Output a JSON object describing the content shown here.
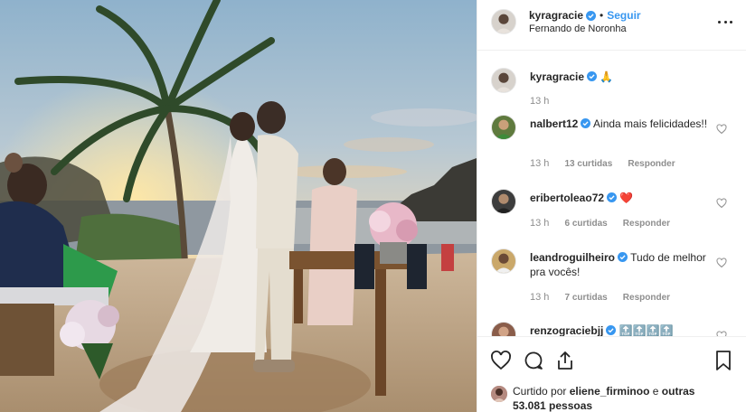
{
  "post": {
    "username": "kyragracie",
    "dot": "•",
    "follow_label": "Seguir",
    "location": "Fernando de Noronha",
    "photo_alt": "wedding on the beach at sunset"
  },
  "comments": [
    {
      "user": "kyragracie",
      "text": "🙏",
      "time": "13 h",
      "likes": "",
      "reply": ""
    },
    {
      "user": "nalbert12",
      "text": "Ainda mais felicidades!!",
      "time": "13 h",
      "likes": "13 curtidas",
      "reply": "Responder"
    },
    {
      "user": "eribertoleao72",
      "text": "❤️",
      "time": "13 h",
      "likes": "6 curtidas",
      "reply": "Responder"
    },
    {
      "user": "leandroguilheiro",
      "text": "Tudo de melhor pra vocês!",
      "time": "13 h",
      "likes": "7 curtidas",
      "reply": "Responder"
    },
    {
      "user": "renzograciebjj",
      "text": "🔝🔝🔝🔝",
      "time": "",
      "likes": "",
      "reply": ""
    }
  ],
  "liked_by": {
    "prefix": "Curtido por",
    "user": "eliene_firminoo",
    "conj": "e",
    "others": "outras 53.081 pessoas"
  },
  "icons": {
    "more": "more-options-icon",
    "verified": "verified-badge-icon",
    "like": "heart-icon",
    "comment": "comment-icon",
    "share": "share-icon",
    "save": "bookmark-icon"
  },
  "colors": {
    "link": "#3897f0",
    "verified": "#3897f0",
    "heart_red": "#ed4956",
    "muted": "#8e8e8e"
  }
}
